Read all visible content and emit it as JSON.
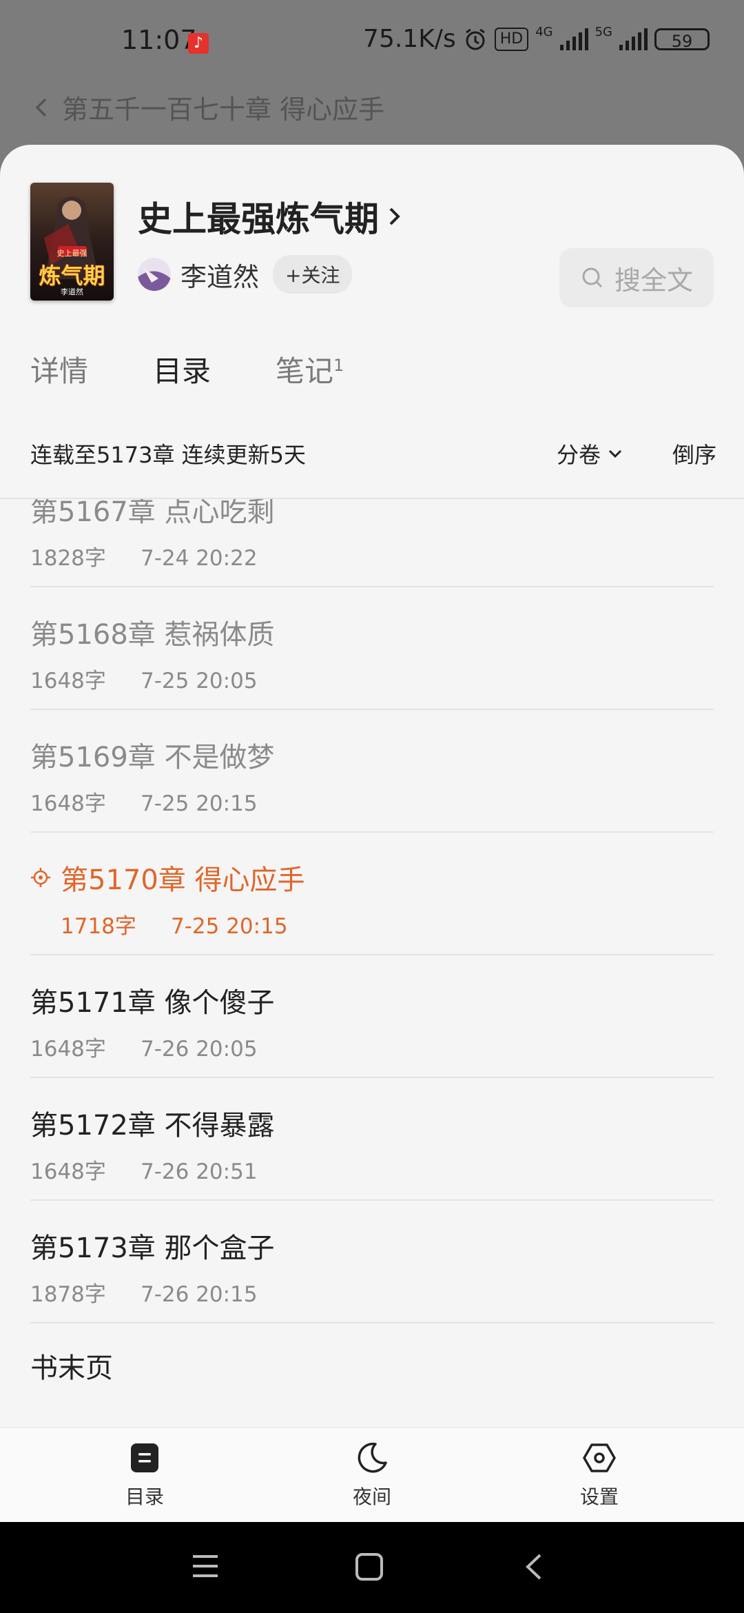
{
  "status_bar": {
    "time": "11:07",
    "network_speed": "75.1K/s",
    "hd_badge": "HD",
    "signal_1": "4G",
    "signal_2": "5G",
    "battery": "59"
  },
  "background_header": {
    "title": "第五千一百七十章 得心应手"
  },
  "book": {
    "title": "史上最强炼气期",
    "cover_text": "炼气期",
    "cover_subtext": "史上最强",
    "cover_author": "李道然",
    "author": "李道然",
    "follow_label": "+关注",
    "search_placeholder": "搜全文"
  },
  "tabs": [
    {
      "label": "详情"
    },
    {
      "label": "目录"
    },
    {
      "label": "笔记",
      "badge": "1"
    }
  ],
  "toc_header": {
    "status": "连载至5173章 连续更新5天",
    "volume_label": "分卷",
    "order_label": "倒序"
  },
  "chapters": [
    {
      "title": "第5167章 点心吃剩",
      "words": "1828字",
      "date": "7-24 20:22",
      "state": "read"
    },
    {
      "title": "第5168章 惹祸体质",
      "words": "1648字",
      "date": "7-25 20:05",
      "state": "read"
    },
    {
      "title": "第5169章 不是做梦",
      "words": "1648字",
      "date": "7-25 20:15",
      "state": "read"
    },
    {
      "title": "第5170章 得心应手",
      "words": "1718字",
      "date": "7-25 20:15",
      "state": "current"
    },
    {
      "title": "第5171章 像个傻子",
      "words": "1648字",
      "date": "7-26 20:05",
      "state": "unread"
    },
    {
      "title": "第5172章 不得暴露",
      "words": "1648字",
      "date": "7-26 20:51",
      "state": "unread"
    },
    {
      "title": "第5173章 那个盒子",
      "words": "1878字",
      "date": "7-26 20:15",
      "state": "unread"
    }
  ],
  "end_page_label": "书末页",
  "bottom_nav": [
    {
      "label": "目录"
    },
    {
      "label": "夜间"
    },
    {
      "label": "设置"
    }
  ],
  "colors": {
    "accent": "#e0662a",
    "sheet_bg": "#f5f5f5",
    "scrim": "#7c7c7c"
  }
}
